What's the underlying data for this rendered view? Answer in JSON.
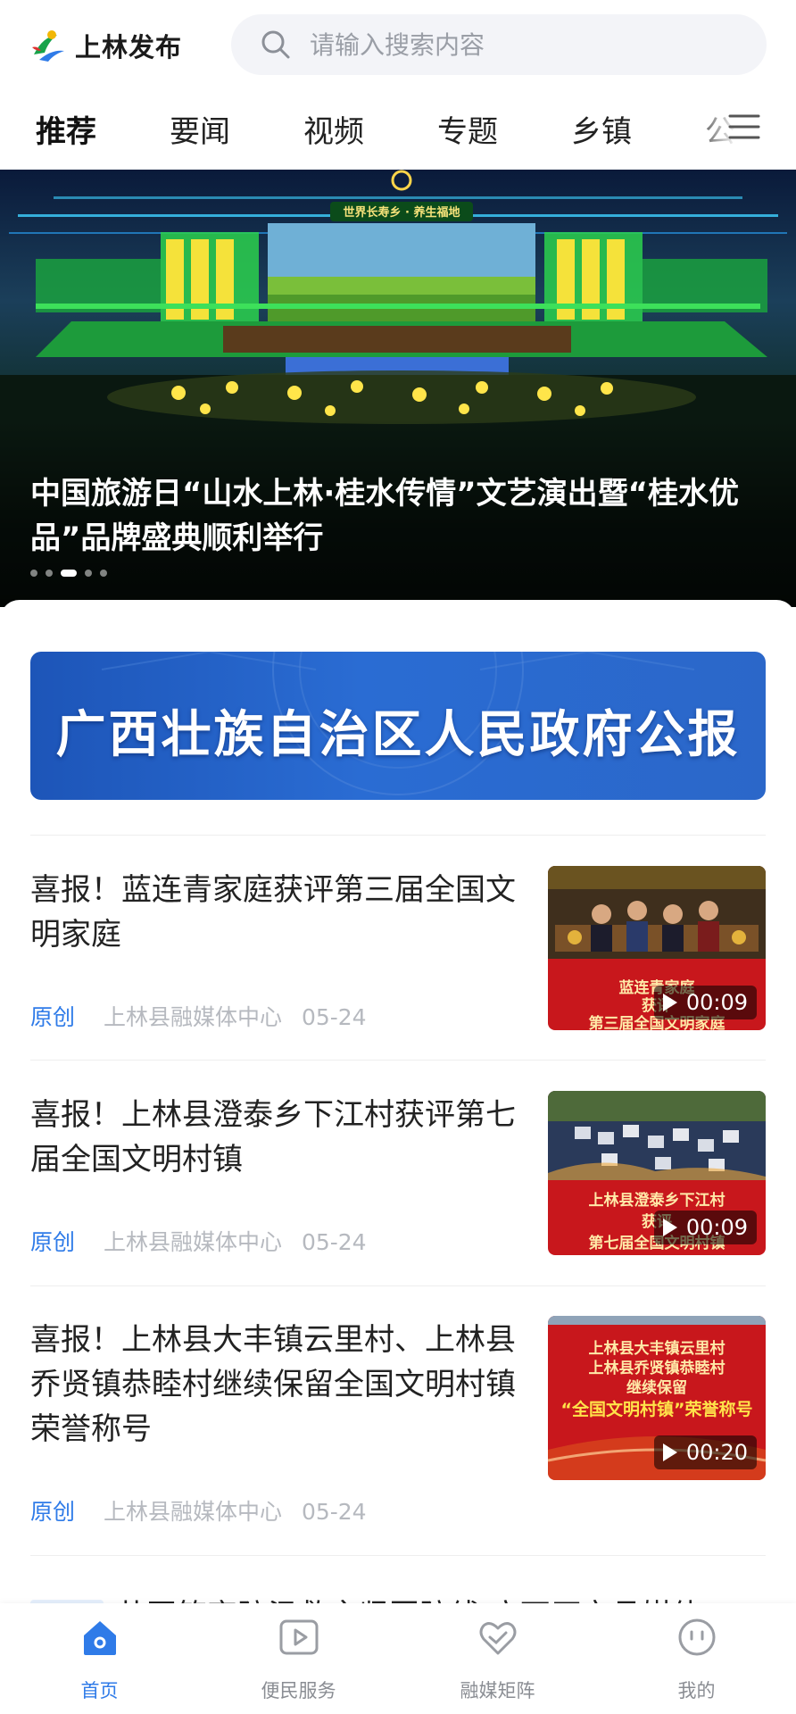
{
  "header": {
    "logo_text": "上林发布",
    "search_placeholder": "请输入搜索内容"
  },
  "tabs": [
    {
      "label": "推荐",
      "active": true
    },
    {
      "label": "要闻"
    },
    {
      "label": "视频"
    },
    {
      "label": "专题"
    },
    {
      "label": "乡镇"
    },
    {
      "label": "公"
    }
  ],
  "banner": {
    "title": "中国旅游日“山水上林·桂水传情”文艺演出暨“桂水优品”品牌盛典顺利举行",
    "stage_sign": "世界长寿乡 · 养生福地",
    "dots_count": 5,
    "active_dot": 2
  },
  "gov_banner": {
    "text": "广西壮族自治区人民政府公报"
  },
  "articles": [
    {
      "title": "喜报！蓝连青家庭获评第三届全国文明家庭",
      "tag": "原创",
      "source": "上林县融媒体中心",
      "date": "05-24",
      "duration": "00:09",
      "thumb_lines": [
        "蓝连青家庭",
        "获评",
        "第三届全国文明家庭"
      ]
    },
    {
      "title": "喜报！上林县澄泰乡下江村获评第七届全国文明村镇",
      "tag": "原创",
      "source": "上林县融媒体中心",
      "date": "05-24",
      "duration": "00:09",
      "thumb_lines": [
        "上林县澄泰乡下江村",
        "获评",
        "第七届全国文明村镇"
      ]
    },
    {
      "title": "喜报！上林县大丰镇云里村、上林县乔贤镇恭睦村继续保留全国文明村镇荣誉称号",
      "tag": "原创",
      "source": "上林县融媒体中心",
      "date": "05-24",
      "duration": "00:20",
      "thumb_lines": [
        "上林县大丰镇云里村",
        "上林县乔贤镇恭睦村",
        "继续保留",
        "“全国文明村镇”荣誉称号"
      ]
    }
  ],
  "partial_article_title": "共同筑牢防汛救灾坚固防线 广西厅市县媒体",
  "bottom_nav": [
    {
      "label": "首页",
      "icon": "home-icon",
      "active": true
    },
    {
      "label": "便民服务",
      "icon": "play-square-icon"
    },
    {
      "label": "融媒矩阵",
      "icon": "heart-icon"
    },
    {
      "label": "我的",
      "icon": "smile-face-icon"
    }
  ],
  "colors": {
    "accent": "#2f7be8",
    "gov_banner": "#2462c6",
    "meta_gray": "#b6b9bf",
    "thumb_red": "#c8171c"
  }
}
